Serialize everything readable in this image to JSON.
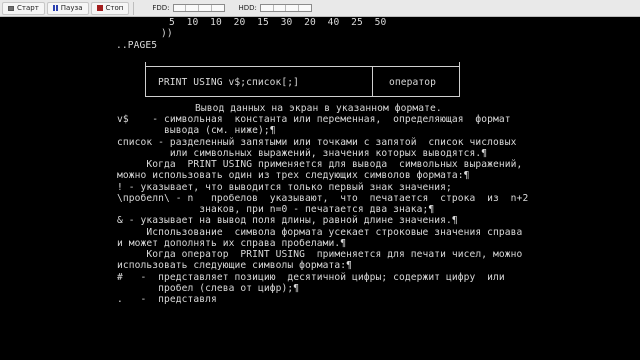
{
  "toolbar": {
    "start_label": "Старт",
    "pause_label": "Пауза",
    "stop_label": "Стоп",
    "fdd_label": "FDD:",
    "hdd_label": "HDD:"
  },
  "screen": {
    "line_numbers": "5  10  10  20  15  30  20  40  25  50",
    "close_brackets": "))",
    "page_marker": "..PAGE5",
    "box_statement": "PRINT USING v$;список[;]",
    "box_type": "оператор",
    "lines": [
      "Вывод данных на экран в указанном формате.",
      "v$    - символьная  константа или переменная,  определяющая  формат",
      "        вывода (см. ниже);¶",
      "список - разделенный запятыми или точками с запятой  список числовых",
      "         или символьных выражений, значения которых выводятся.¶",
      "     Когда  PRINT USING применяется для вывода  символьных выражений,",
      "можно использовать один из трех следующих символов формата:¶",
      "! - указывает, что выводится только первый знак значения;",
      "\\пробелn\\ - n   пробелов  указывают,  что  печатается  строка  из  n+2",
      "              знаков, при n=0 - печатается два знака;¶",
      "& - указывает на вывод поля длины, равной длине значения.¶",
      "     Использование  символа формата усекает строковые значения справа",
      "и может дополнять их справа пробелами.¶",
      "     Когда оператор  PRINT USING  применяется для печати чисел, можно",
      "использовать следующие символы формата:¶",
      "#   -  представляет позицию  десятичной цифры; содержит цифру  или",
      "       пробел (слева от цифр);¶",
      ".   -  представля"
    ]
  }
}
